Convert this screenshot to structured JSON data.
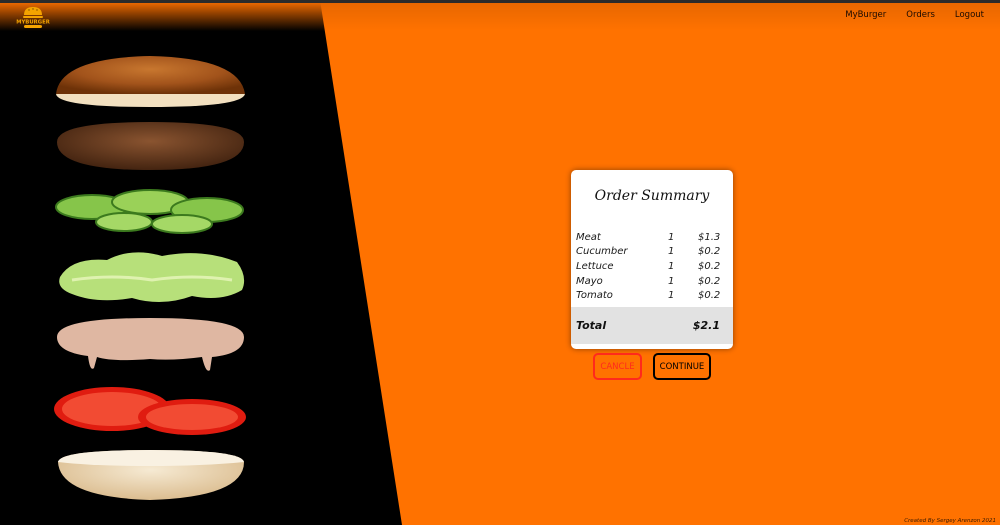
{
  "brand": {
    "logo_text": "MYBURGER"
  },
  "nav": {
    "items": [
      "MyBurger",
      "Orders",
      "Logout"
    ]
  },
  "order_summary": {
    "title": "Order Summary",
    "items": [
      {
        "name": "Meat",
        "qty": "1",
        "price": "$1.3"
      },
      {
        "name": "Cucumber",
        "qty": "1",
        "price": "$0.2"
      },
      {
        "name": "Lettuce",
        "qty": "1",
        "price": "$0.2"
      },
      {
        "name": "Mayo",
        "qty": "1",
        "price": "$0.2"
      },
      {
        "name": "Tomato",
        "qty": "1",
        "price": "$0.2"
      }
    ],
    "total_label": "Total",
    "total_value": "$2.1"
  },
  "actions": {
    "cancel_label": "CANCLE",
    "continue_label": "CONTINUE"
  },
  "footer": {
    "text": "Created By Sergey Arenzon 2021"
  },
  "colors": {
    "background": "#ff7200",
    "panel": "#000000",
    "cancel": "#ff2a1c",
    "total_bar": "#e2e2e2"
  }
}
